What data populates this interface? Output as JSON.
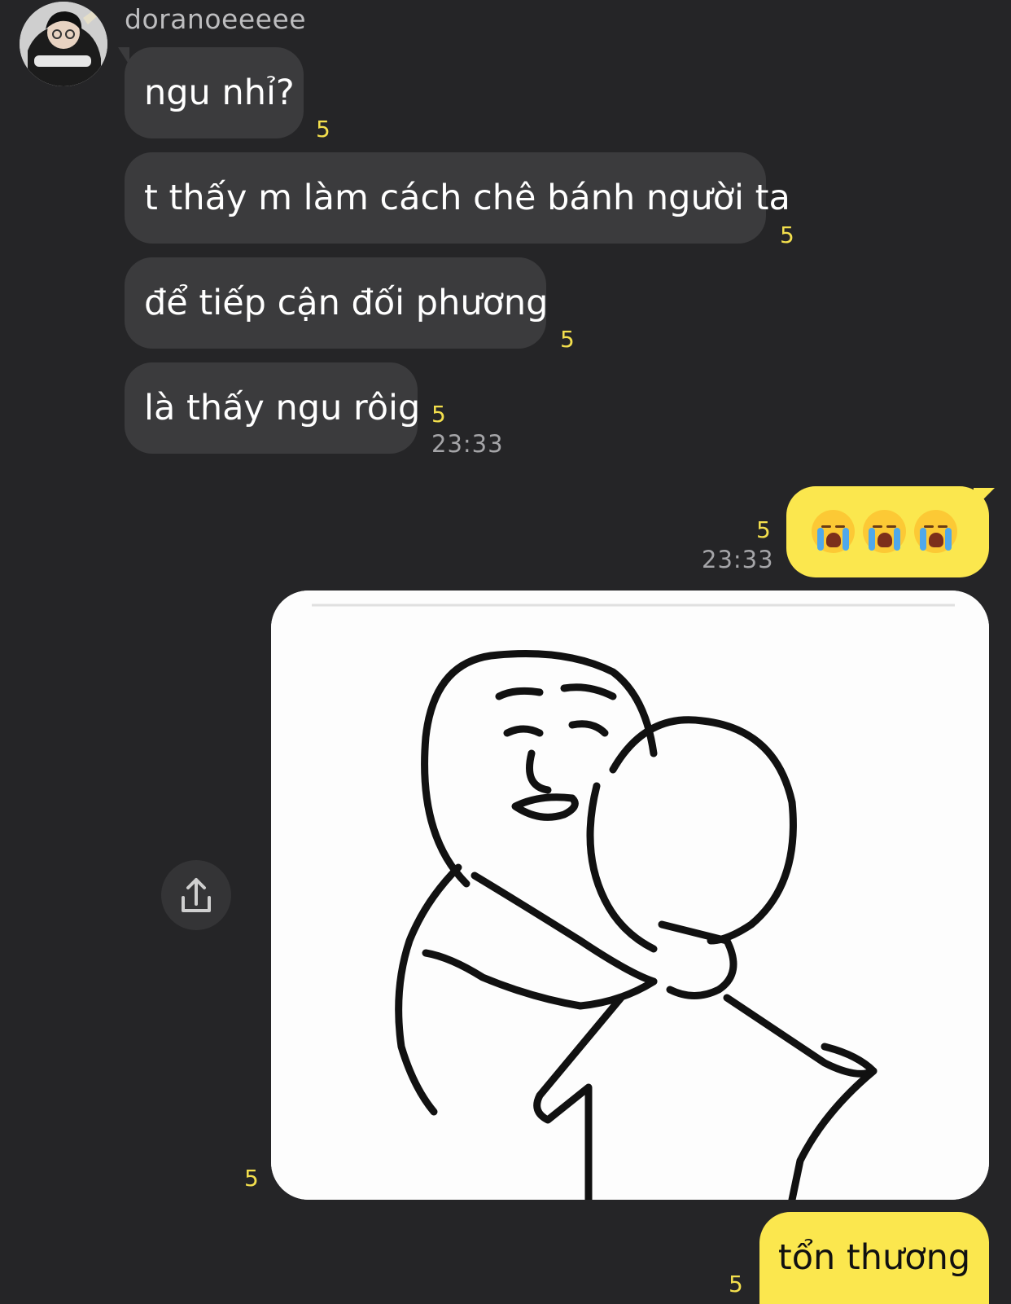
{
  "sender": {
    "name": "doranoeeeee"
  },
  "incoming": [
    {
      "text": "ngu nhỉ?",
      "count": "5"
    },
    {
      "text": "t thấy m làm cách chê bánh người ta",
      "count": "5"
    },
    {
      "text": "để tiếp cận đối phương",
      "count": "5"
    },
    {
      "text": "là thấy ngu rôig",
      "count": "5",
      "time": "23:33"
    }
  ],
  "outgoing": [
    {
      "type": "emoji",
      "emoji": "😭😭😭",
      "icon": "loudly-crying-face-icon",
      "count": "5",
      "time": "23:33"
    },
    {
      "type": "image",
      "icon": "meme-hug-image",
      "count": "5"
    },
    {
      "type": "text",
      "text": "tổn thương",
      "count": "5"
    }
  ],
  "actions": {
    "share_icon": "share-icon"
  },
  "colors": {
    "background": "#252527",
    "incoming_bubble": "#3b3b3d",
    "outgoing_bubble": "#fbe74e",
    "unread_count": "#f3df4d",
    "timestamp": "#a5a5a8"
  }
}
